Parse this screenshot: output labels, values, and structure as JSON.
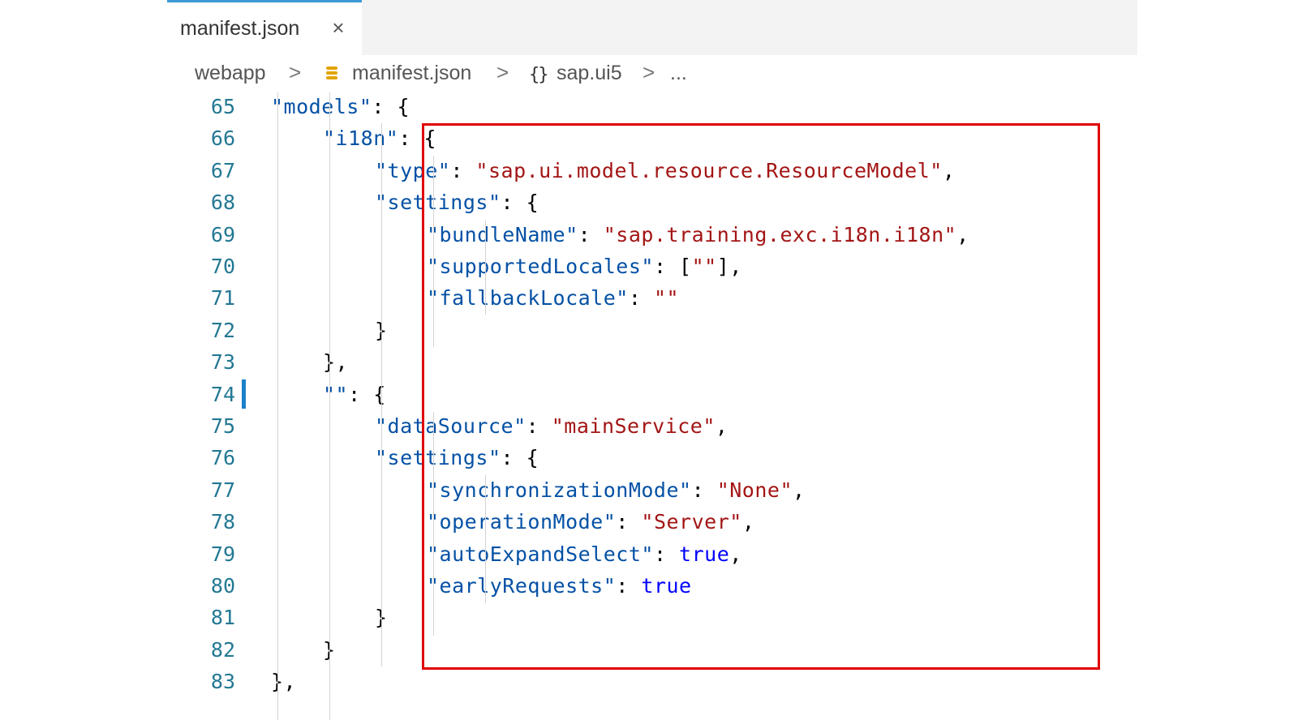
{
  "tab": {
    "label": "manifest.json",
    "close": "×"
  },
  "breadcrumb": {
    "items": [
      "webapp",
      "manifest.json",
      "sap.ui5",
      "..."
    ],
    "separator": ">",
    "brace_glyph": "{}"
  },
  "code": {
    "lines": [
      {
        "num": "65",
        "indent": 2,
        "tokens": [
          [
            "k",
            "\"models\""
          ],
          [
            "p",
            ": {"
          ]
        ]
      },
      {
        "num": "66",
        "indent": 3,
        "tokens": [
          [
            "k",
            "\"i18n\""
          ],
          [
            "p",
            ": {"
          ]
        ]
      },
      {
        "num": "67",
        "indent": 4,
        "tokens": [
          [
            "k",
            "\"type\""
          ],
          [
            "p",
            ": "
          ],
          [
            "s",
            "\"sap.ui.model.resource.ResourceModel\""
          ],
          [
            "p",
            ","
          ]
        ]
      },
      {
        "num": "68",
        "indent": 4,
        "tokens": [
          [
            "k",
            "\"settings\""
          ],
          [
            "p",
            ": {"
          ]
        ]
      },
      {
        "num": "69",
        "indent": 5,
        "tokens": [
          [
            "k",
            "\"bundleName\""
          ],
          [
            "p",
            ": "
          ],
          [
            "s",
            "\"sap.training.exc.i18n.i18n\""
          ],
          [
            "p",
            ","
          ]
        ]
      },
      {
        "num": "70",
        "indent": 5,
        "tokens": [
          [
            "k",
            "\"supportedLocales\""
          ],
          [
            "p",
            ": ["
          ],
          [
            "s",
            "\"\""
          ],
          [
            "p",
            "],"
          ]
        ]
      },
      {
        "num": "71",
        "indent": 5,
        "tokens": [
          [
            "k",
            "\"fallbackLocale\""
          ],
          [
            "p",
            ": "
          ],
          [
            "s",
            "\"\""
          ]
        ]
      },
      {
        "num": "72",
        "indent": 4,
        "tokens": [
          [
            "p",
            "}"
          ]
        ]
      },
      {
        "num": "73",
        "indent": 3,
        "tokens": [
          [
            "p",
            "},"
          ]
        ]
      },
      {
        "num": "74",
        "indent": 3,
        "tokens": [
          [
            "k",
            "\"\""
          ],
          [
            "p",
            ": {"
          ]
        ]
      },
      {
        "num": "75",
        "indent": 4,
        "tokens": [
          [
            "k",
            "\"dataSource\""
          ],
          [
            "p",
            ": "
          ],
          [
            "s",
            "\"mainService\""
          ],
          [
            "p",
            ","
          ]
        ]
      },
      {
        "num": "76",
        "indent": 4,
        "tokens": [
          [
            "k",
            "\"settings\""
          ],
          [
            "p",
            ": {"
          ]
        ]
      },
      {
        "num": "77",
        "indent": 5,
        "tokens": [
          [
            "k",
            "\"synchronizationMode\""
          ],
          [
            "p",
            ": "
          ],
          [
            "s",
            "\"None\""
          ],
          [
            "p",
            ","
          ]
        ]
      },
      {
        "num": "78",
        "indent": 5,
        "tokens": [
          [
            "k",
            "\"operationMode\""
          ],
          [
            "p",
            ": "
          ],
          [
            "s",
            "\"Server\""
          ],
          [
            "p",
            ","
          ]
        ]
      },
      {
        "num": "79",
        "indent": 5,
        "tokens": [
          [
            "k",
            "\"autoExpandSelect\""
          ],
          [
            "p",
            ": "
          ],
          [
            "b",
            "true"
          ],
          [
            "p",
            ","
          ]
        ]
      },
      {
        "num": "80",
        "indent": 5,
        "tokens": [
          [
            "k",
            "\"earlyRequests\""
          ],
          [
            "p",
            ": "
          ],
          [
            "b",
            "true"
          ]
        ]
      },
      {
        "num": "81",
        "indent": 4,
        "tokens": [
          [
            "p",
            "}"
          ]
        ]
      },
      {
        "num": "82",
        "indent": 3,
        "tokens": [
          [
            "p",
            "}"
          ]
        ]
      },
      {
        "num": "83",
        "indent": 2,
        "tokens": [
          [
            "p",
            "},"
          ]
        ]
      }
    ]
  },
  "colors": {
    "key": "#0451a5",
    "string": "#a31515",
    "boolean": "#0000ff",
    "line_number": "#237893",
    "highlight_border": "#e00000",
    "modified_bar": "#1b81c9"
  }
}
